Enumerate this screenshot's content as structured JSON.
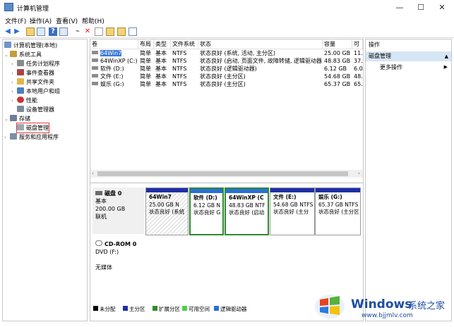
{
  "window": {
    "title": "计算机管理",
    "minimize": "—",
    "maximize": "☐",
    "close": "✕"
  },
  "menu": [
    "文件(F)",
    "操作(A)",
    "查看(V)",
    "帮助(H)"
  ],
  "toolbar_icons": [
    "back-icon",
    "forward-icon",
    "up-folder-icon",
    "show-tree-icon",
    "help-icon",
    "console-icon",
    "connect-icon",
    "delete-icon",
    "properties-icon",
    "open-icon",
    "export-icon",
    "view-icon"
  ],
  "tree": {
    "root": "计算机管理(本地)",
    "system_tools": "系统工具",
    "items": [
      "任务计划程序",
      "事件查看器",
      "共享文件夹",
      "本地用户和组",
      "性能",
      "设备管理器"
    ],
    "storage": "存储",
    "disk_mgmt": "磁盘管理",
    "services": "服务和应用程序"
  },
  "table": {
    "headers": [
      "卷",
      "布局",
      "类型",
      "文件系统",
      "状态",
      "容量",
      "可"
    ],
    "rows": [
      {
        "vol": "64Win7",
        "layout": "简单",
        "type": "基本",
        "fs": "NTFS",
        "status": "状态良好 (系统, 活动, 主分区)",
        "cap": "25.00 GB",
        "free": "11."
      },
      {
        "vol": "64WinXP  (C:)",
        "layout": "简单",
        "type": "基本",
        "fs": "NTFS",
        "status": "状态良好 (启动, 页面文件, 故障转储, 逻辑驱动器)",
        "cap": "48.83 GB",
        "free": "37."
      },
      {
        "vol": "软件 (D:)",
        "layout": "简单",
        "type": "基本",
        "fs": "NTFS",
        "status": "状态良好 (逻辑驱动器)",
        "cap": "6.12 GB",
        "free": "6.0"
      },
      {
        "vol": "文件 (E:)",
        "layout": "简单",
        "type": "基本",
        "fs": "NTFS",
        "status": "状态良好 (主分区)",
        "cap": "54.68 GB",
        "free": "48."
      },
      {
        "vol": "娱乐 (G:)",
        "layout": "简单",
        "type": "基本",
        "fs": "NTFS",
        "status": "状态良好 (主分区)",
        "cap": "65.37 GB",
        "free": "65."
      }
    ]
  },
  "disk0": {
    "name": "磁盘 0",
    "kind": "基本",
    "size": "200.00 GB",
    "state": "联机",
    "partitions": [
      {
        "name": "64Win7",
        "size": "25.00 GB N",
        "status": "状态良好 (系统"
      },
      {
        "name": "软件  (D:)",
        "size": "6.12 GB N",
        "status": "状态良好 G"
      },
      {
        "name": "64WinXP  (C",
        "size": "48.83 GB NTF",
        "status": "状态良好 (启动"
      },
      {
        "name": "文件  (E:)",
        "size": "54.68 GB NTFS",
        "status": "状态良好 (主分"
      },
      {
        "name": "娱乐  (G:)",
        "size": "65.37 GB NTFS",
        "status": "状态良好 (主分区"
      }
    ]
  },
  "cdrom": {
    "name": "CD-ROM 0",
    "drive": "DVD (F:)",
    "media": "无媒体"
  },
  "legend": [
    "未分配",
    "主分区",
    "扩展分区",
    "可用空间",
    "逻辑驱动器"
  ],
  "colors": {
    "unalloc": "#000000",
    "primary": "#1f2fa6",
    "extended": "#2e8b2e",
    "free": "#4cd14c",
    "logical": "#2a6fd6"
  },
  "actions": {
    "title": "操作",
    "disk": "磁盘管理",
    "more": "更多操作"
  },
  "watermark": {
    "brand": "Windows",
    "cn": "系统之家",
    "url": "www.bjjmlv.com"
  }
}
